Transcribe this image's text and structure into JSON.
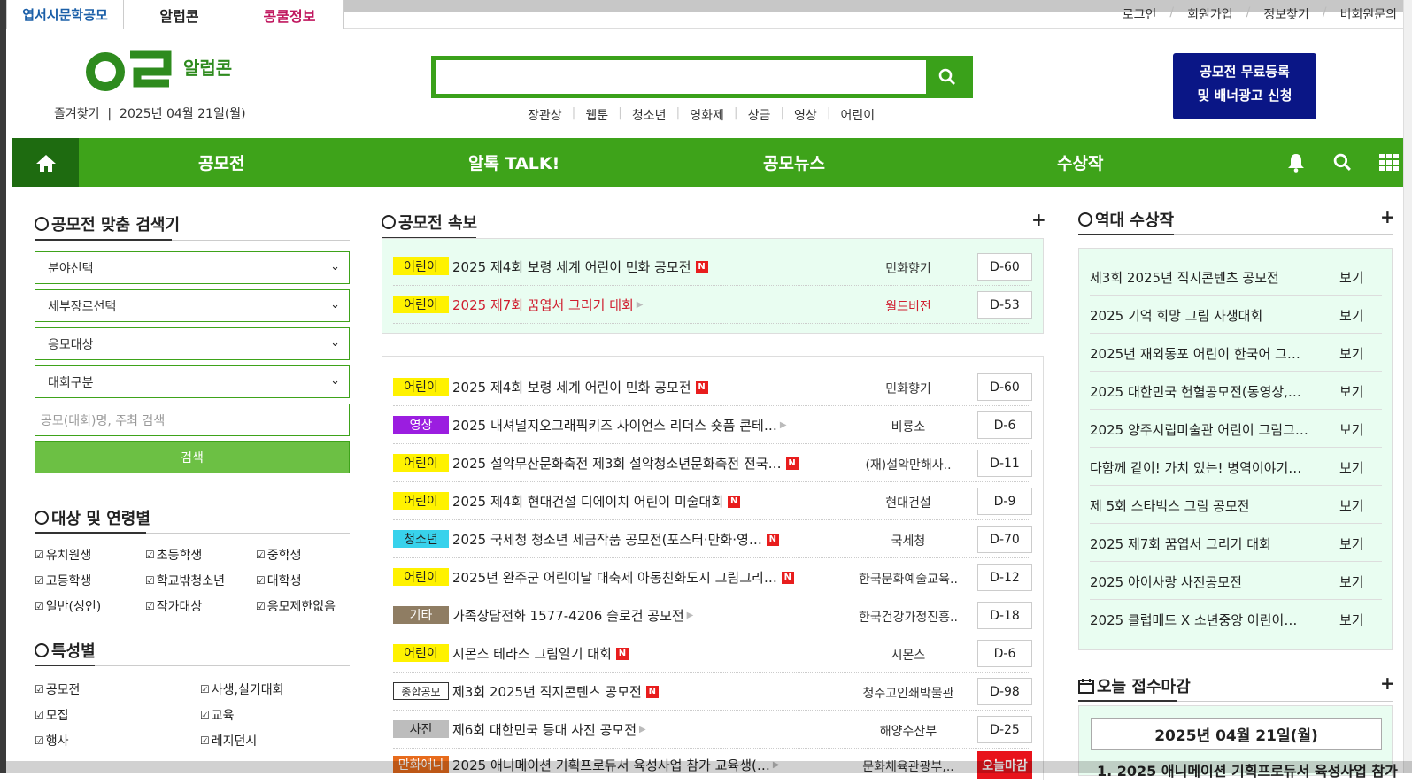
{
  "top_tabs": [
    {
      "label": "엽서시문학공모",
      "color": "#1b5fa8"
    },
    {
      "label": "알럽콘",
      "color": "#222"
    },
    {
      "label": "콩쿨정보",
      "color": "#c0175f"
    }
  ],
  "top_links": [
    "로그인",
    "회원가입",
    "정보찾기",
    "비회원문의"
  ],
  "logo": {
    "mark": "ㅇㄹ",
    "text": "알럽콘"
  },
  "dateline": "즐겨찾기  |  2025년 04월 21일(월)",
  "search": {
    "placeholder": ""
  },
  "tags": [
    "장관상",
    "웹툰",
    "청소년",
    "영화제",
    "상금",
    "영상",
    "어린이"
  ],
  "banner": {
    "line1": "공모전 무료등록",
    "line2": "및 배너광고 신청"
  },
  "nav": {
    "items": [
      "공모전",
      "알톡 TALK!",
      "공모뉴스",
      "수상작"
    ]
  },
  "left": {
    "finder_title": "공모전 맞춤 검색기",
    "selects": [
      "분야선택",
      "세부장르선택",
      "응모대상",
      "대회구분"
    ],
    "search_placeholder": "공모(대회)명, 주최 검색",
    "search_button": "검색",
    "age_title": "대상 및 연령별",
    "age_items": [
      "유치원생",
      "초등학생",
      "중학생",
      "고등학생",
      "학교밖청소년",
      "대학생",
      "일반(성인)",
      "작가대상",
      "응모제한없음"
    ],
    "feature_title": "특성별",
    "feature_items": [
      "공모전",
      "사생,실기대회",
      "모집",
      "교육",
      "행사",
      "레지던시"
    ]
  },
  "flash": {
    "title": "공모전 속보",
    "plus": "+",
    "rows": [
      {
        "badge": "어린이",
        "title": "2025 제4회 보령 세계 어린이 민화 공모전",
        "new": true,
        "host": "민화향기",
        "dday": "D-60",
        "red": false
      },
      {
        "badge": "어린이",
        "title": "2025 제7회 꿈엽서 그리기 대회",
        "new": false,
        "host": "월드비전",
        "dday": "D-53",
        "red": true
      }
    ]
  },
  "list": {
    "rows": [
      {
        "badge": "어린이",
        "badge_style": "yellow",
        "title": "2025 제4회 보령 세계 어린이 민화 공모전",
        "new": true,
        "host": "민화향기",
        "dday": "D-60"
      },
      {
        "badge": "영상",
        "badge_style": "purple",
        "title": "2025 내셔널지오그래픽키즈 사이언스 리더스 숏폼 콘테…",
        "new": false,
        "host": "비룡소",
        "dday": "D-6"
      },
      {
        "badge": "어린이",
        "badge_style": "yellow",
        "title": "2025 설악무산문화축전 제3회 설악청소년문화축전 전국…",
        "new": true,
        "host": "(재)설악만해사..",
        "dday": "D-11"
      },
      {
        "badge": "어린이",
        "badge_style": "yellow",
        "title": "2025 제4회 현대건설 디에이치 어린이 미술대회",
        "new": true,
        "host": "현대건설",
        "dday": "D-9"
      },
      {
        "badge": "청소년",
        "badge_style": "cyan",
        "title": "2025 국세청 청소년 세금작품 공모전(포스터·만화·영…",
        "new": true,
        "host": "국세청",
        "dday": "D-70"
      },
      {
        "badge": "어린이",
        "badge_style": "yellow",
        "title": "2025년 완주군 어린이날 대축제 아동친화도시 그림그리…",
        "new": true,
        "host": "한국문화예술교육..",
        "dday": "D-12"
      },
      {
        "badge": "기타",
        "badge_style": "brown",
        "title": "가족상담전화 1577-4206 슬로건 공모전",
        "new": false,
        "host": "한국건강가정진흥..",
        "dday": "D-18"
      },
      {
        "badge": "어린이",
        "badge_style": "yellow",
        "title": "시몬스 테라스 그림일기 대회",
        "new": true,
        "host": "시몬스",
        "dday": "D-6"
      },
      {
        "badge": "종합공모",
        "badge_style": "outline",
        "title": "제3회 2025년 직지콘텐츠 공모전",
        "new": true,
        "host": "청주고인쇄박물관",
        "dday": "D-98"
      },
      {
        "badge": "사진",
        "badge_style": "gray",
        "title": "제6회 대한민국 등대 사진 공모전",
        "new": false,
        "host": "해양수산부",
        "dday": "D-25"
      },
      {
        "badge": "만화애니",
        "badge_style": "orange",
        "title": "2025 애니메이션 기획프로듀서 육성사업 참가 교육생(…",
        "new": false,
        "host": "문화체육관광부,..",
        "dday": "오늘마감"
      }
    ]
  },
  "awards": {
    "title": "역대 수상작",
    "plus": "+",
    "rows": [
      {
        "title": "제3회 2025년 직지콘텐츠 공모전",
        "view": "보기"
      },
      {
        "title": "2025 기억 희망 그림 사생대회",
        "view": "보기"
      },
      {
        "title": "2025년 재외동포 어린이 한국어 그…",
        "view": "보기"
      },
      {
        "title": "2025 대한민국 헌혈공모전(동영상,…",
        "view": "보기"
      },
      {
        "title": "2025 양주시립미술관 어린이 그림그…",
        "view": "보기"
      },
      {
        "title": "다함께 같이! 가치 있는! 병역이야기…",
        "view": "보기"
      },
      {
        "title": "제 5회 스타벅스 그림 공모전",
        "view": "보기"
      },
      {
        "title": "2025 제7회 꿈엽서 그리기 대회",
        "view": "보기"
      },
      {
        "title": "2025 아이사랑 사진공모전",
        "view": "보기"
      },
      {
        "title": "2025 클럽메드 X 소년중앙 어린이…",
        "view": "보기"
      }
    ]
  },
  "today": {
    "title": "오늘 접수마감",
    "plus": "+",
    "date": "2025년 04월 21일(월)",
    "first_item": "1. 2025 애니메이션 기획프로듀서 육성사업 참가"
  },
  "colors": {
    "brand_green": "#3ea31a",
    "dark_green": "#1e6b10",
    "banner_navy": "#0a1686",
    "light_mint": "#e9fdf1"
  }
}
